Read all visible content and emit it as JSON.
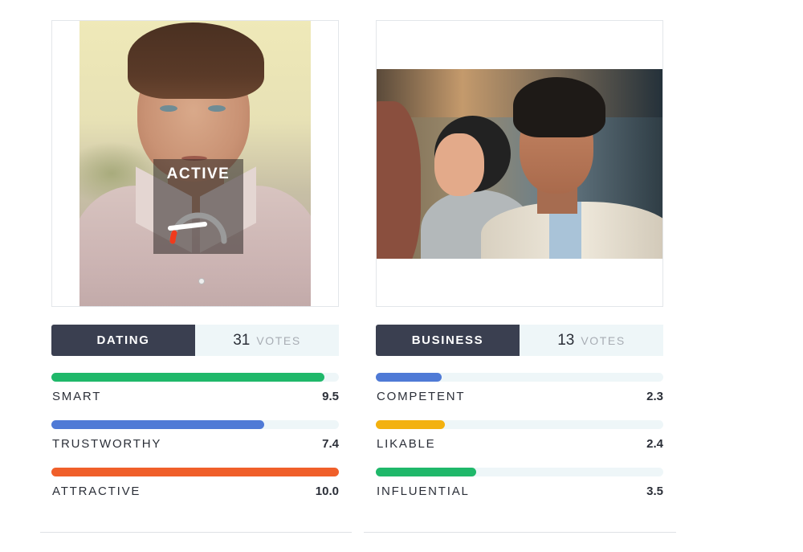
{
  "cards": [
    {
      "category": "DATING",
      "votes_count": "31",
      "votes_label": "VOTES",
      "status_label": "ACTIVE",
      "traits": [
        {
          "name": "SMART",
          "value": "9.5",
          "fraction": 0.95,
          "color": "#1fb86a"
        },
        {
          "name": "TRUSTWORTHY",
          "value": "7.4",
          "fraction": 0.74,
          "color": "#4f7ad6"
        },
        {
          "name": "ATTRACTIVE",
          "value": "10.0",
          "fraction": 1.0,
          "color": "#f05f2a"
        }
      ]
    },
    {
      "category": "BUSINESS",
      "votes_count": "13",
      "votes_label": "VOTES",
      "traits": [
        {
          "name": "COMPETENT",
          "value": "2.3",
          "fraction": 0.23,
          "color": "#4f7ad6"
        },
        {
          "name": "LIKABLE",
          "value": "2.4",
          "fraction": 0.24,
          "color": "#f3b10f"
        },
        {
          "name": "INFLUENTIAL",
          "value": "3.5",
          "fraction": 0.35,
          "color": "#1fb86a"
        }
      ]
    }
  ],
  "colors": {
    "category_button_bg": "#3a3f50",
    "votes_box_bg": "#eef6f8",
    "track_bg": "#eef6f8",
    "gauge_needle": "#f03a1c"
  }
}
